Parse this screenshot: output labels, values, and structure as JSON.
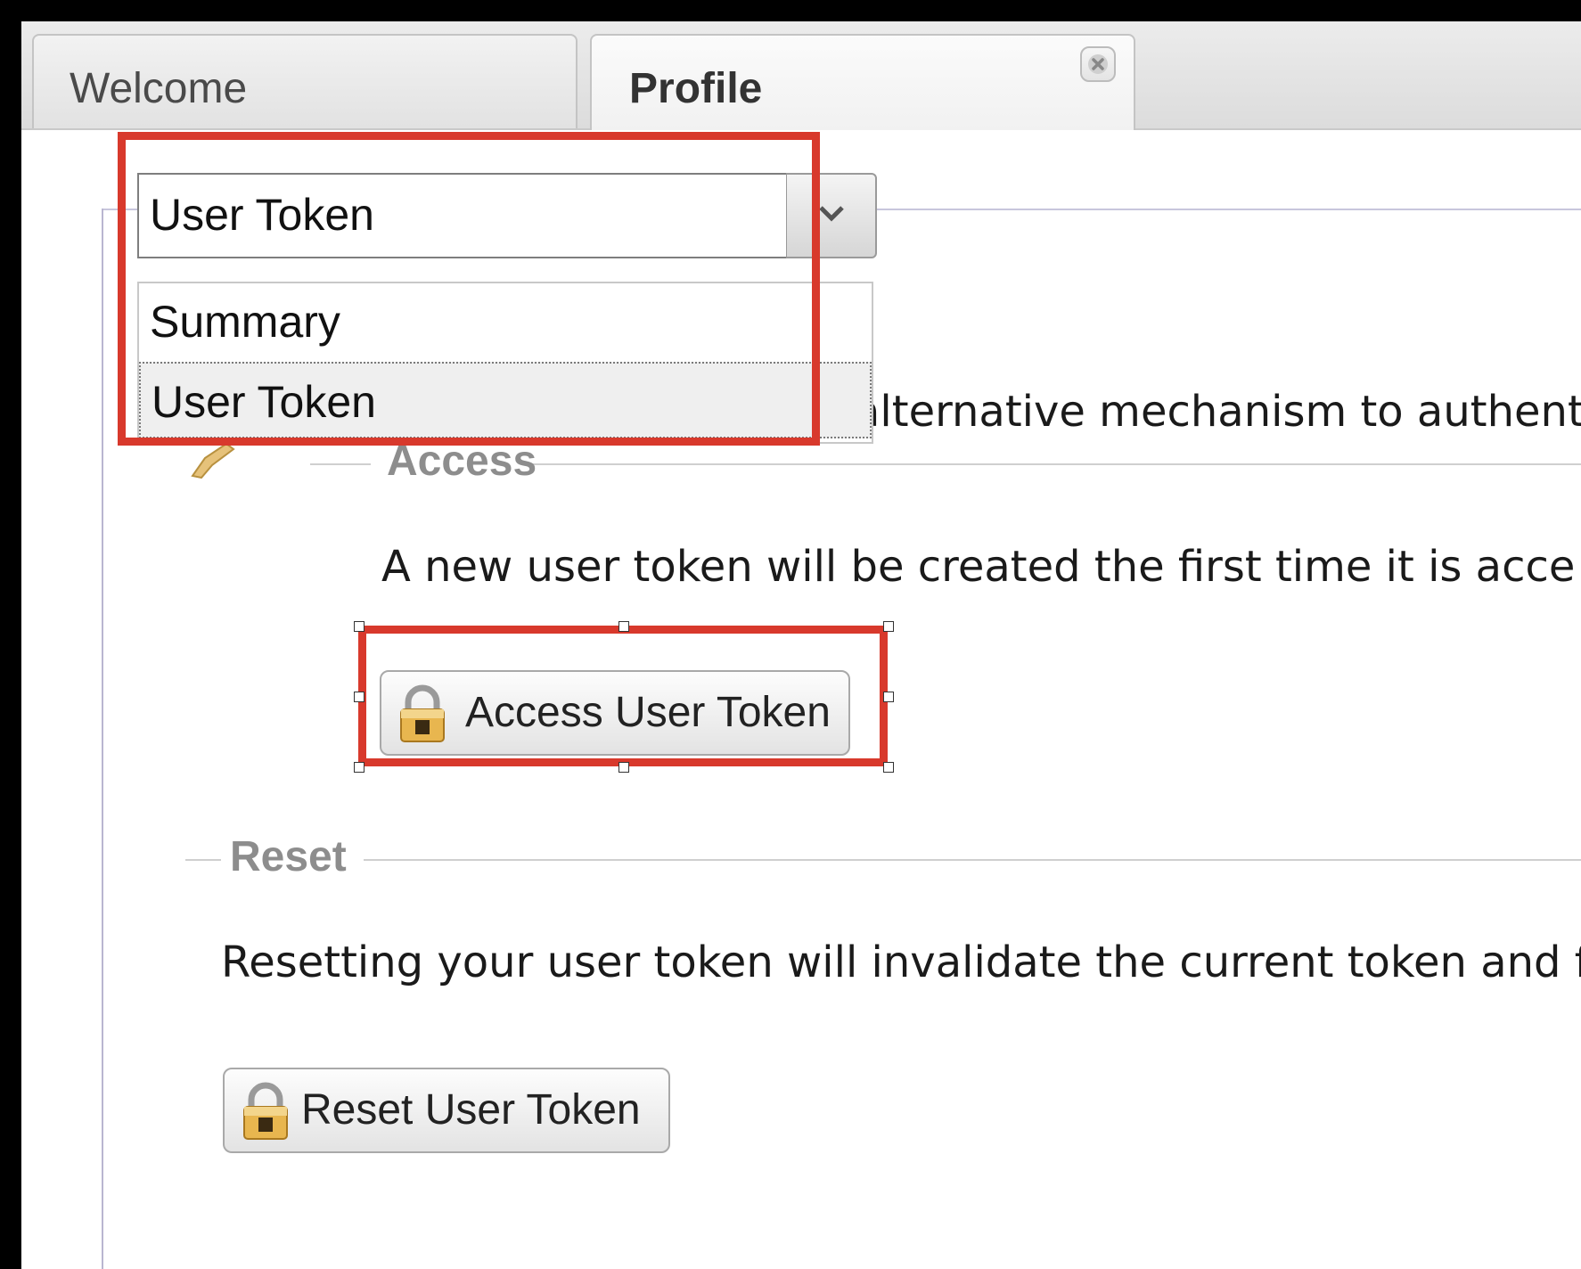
{
  "tabs": [
    {
      "label": "Welcome",
      "active": false
    },
    {
      "label": "Profile",
      "active": true,
      "closable": true
    }
  ],
  "select": {
    "value": "User Token",
    "options": [
      "Summary",
      "User Token"
    ],
    "highlighted_option": "User Token"
  },
  "description": "alternative mechanism to authenti",
  "access_section": {
    "title": "Access",
    "text": "A new user token will be created the first time it is acce",
    "button_label": "Access User Token",
    "button_icon": "lock-icon"
  },
  "reset_section": {
    "title": "Reset",
    "text": "Resetting your user token will invalidate the current token and f",
    "button_label": "Reset User Token",
    "button_icon": "lock-icon"
  },
  "colors": {
    "highlight": "#d8392c",
    "section_title": "#8d8d8d"
  }
}
